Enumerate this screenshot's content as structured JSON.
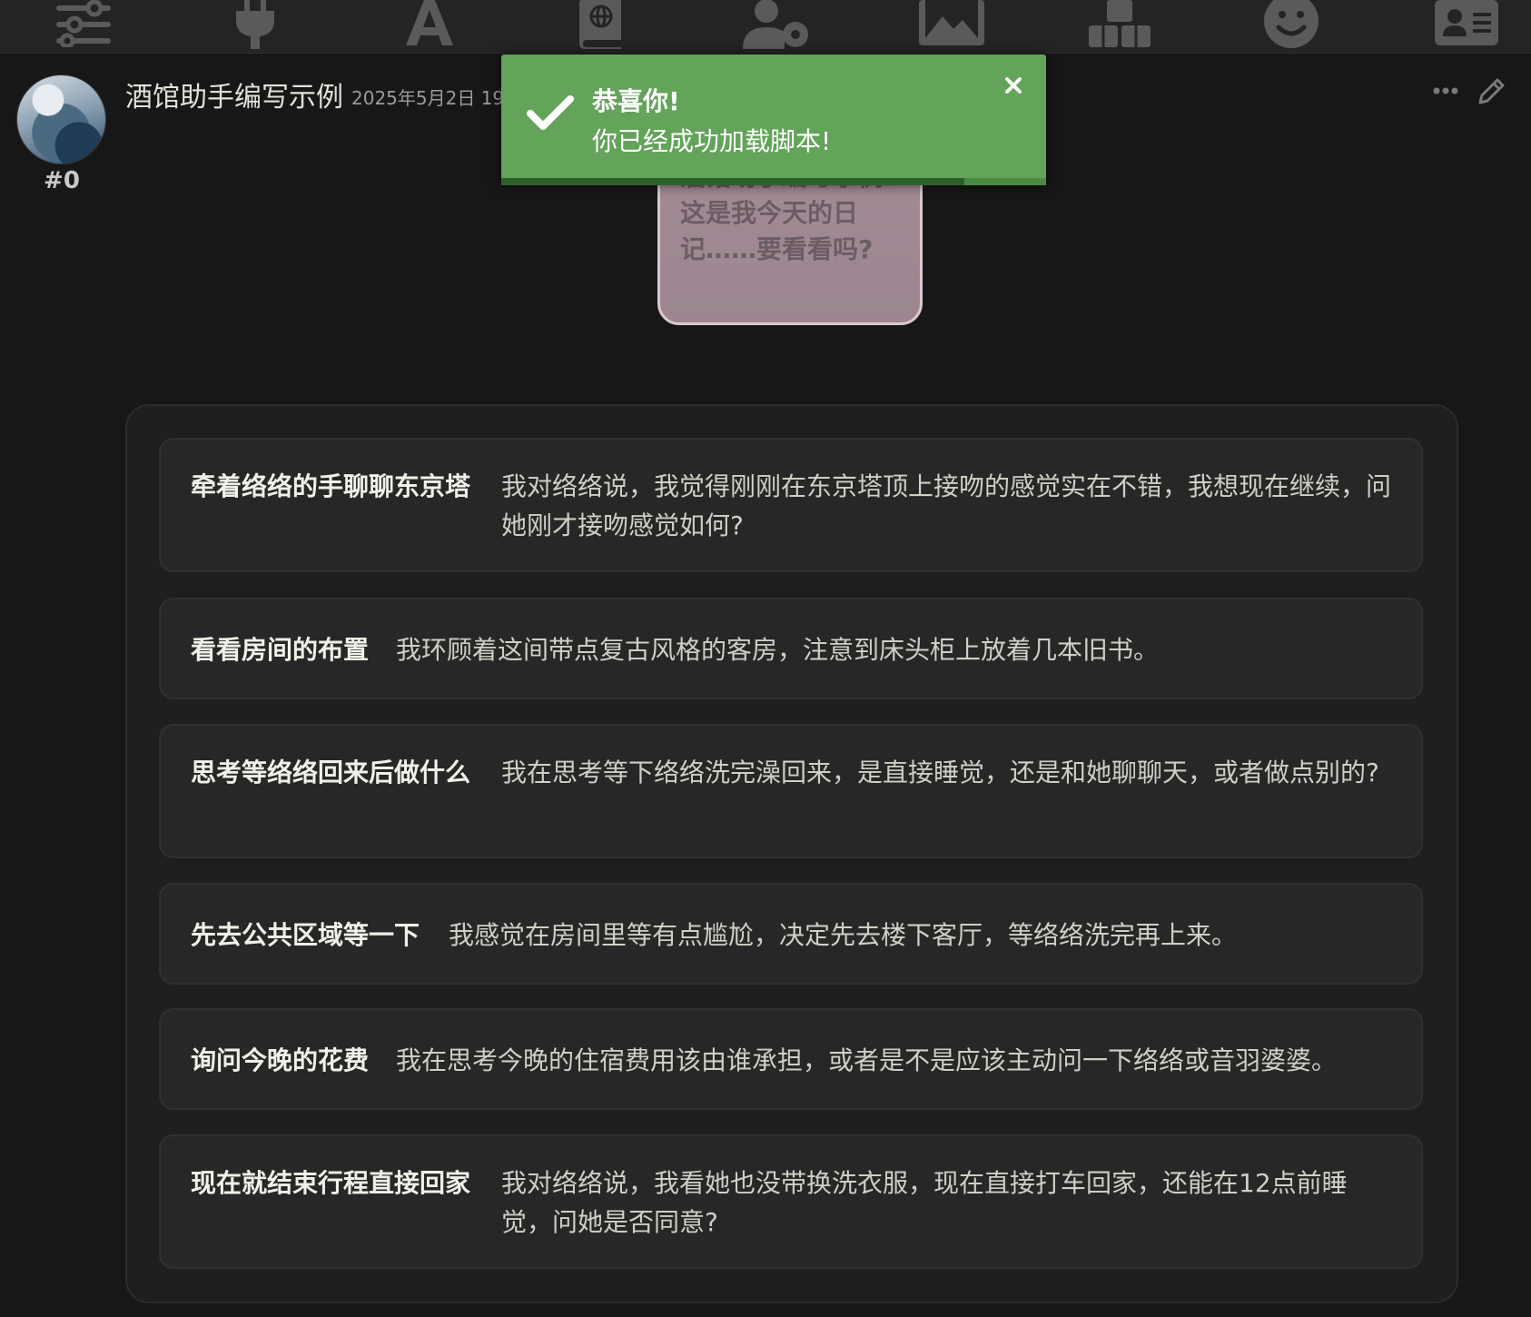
{
  "toolbar": {
    "icons": [
      "sliders-icon",
      "plug-icon",
      "font-a-icon",
      "book-globe-icon",
      "user-gear-icon",
      "image-icon",
      "cubes-icon",
      "smile-icon",
      "id-card-icon"
    ]
  },
  "message": {
    "index": "#0",
    "character_name": "酒馆助手编写示例",
    "timestamp": "2025年5月2日 19"
  },
  "bubble": {
    "text": "酒馆助手编写示例: 这是我今天的日记……要看看吗?"
  },
  "toast": {
    "title": "恭喜你!",
    "message": "你已经成功加载脚本!",
    "color": "#63a35a",
    "progress": 0.85
  },
  "options": [
    {
      "title": "牵着络络的手聊聊东京塔",
      "description": "我对络络说，我觉得刚刚在东京塔顶上接吻的感觉实在不错，我想现在继续，问她刚才接吻感觉如何?"
    },
    {
      "title": "看看房间的布置",
      "description": "我环顾着这间带点复古风格的客房，注意到床头柜上放着几本旧书。"
    },
    {
      "title": "思考等络络回来后做什么",
      "description": "我在思考等下络络洗完澡回来，是直接睡觉，还是和她聊聊天，或者做点别的?"
    },
    {
      "title": "先去公共区域等一下",
      "description": "我感觉在房间里等有点尴尬，决定先去楼下客厅，等络络洗完再上来。"
    },
    {
      "title": "询问今晚的花费",
      "description": "我在思考今晚的住宿费用该由谁承担，或者是不是应该主动问一下络络或音羽婆婆。"
    },
    {
      "title": "现在就结束行程直接回家",
      "description": "我对络络说，我看她也没带换洗衣服，现在直接打车回家，还能在12点前睡觉，问她是否同意?"
    }
  ]
}
